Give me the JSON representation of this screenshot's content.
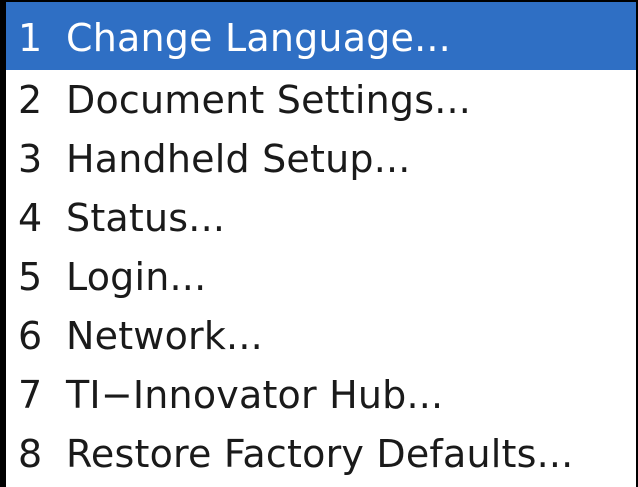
{
  "menu": {
    "selected_index": 0,
    "items": [
      {
        "num": "1",
        "label": "Change Language..."
      },
      {
        "num": "2",
        "label": "Document Settings..."
      },
      {
        "num": "3",
        "label": "Handheld Setup..."
      },
      {
        "num": "4",
        "label": "Status..."
      },
      {
        "num": "5",
        "label": "Login..."
      },
      {
        "num": "6",
        "label": "Network..."
      },
      {
        "num": "7",
        "label": "TI−Innovator Hub..."
      },
      {
        "num": "8",
        "label": "Restore Factory Defaults..."
      }
    ]
  },
  "colors": {
    "selection": "#2f6fc4",
    "text": "#1a1a1a",
    "selected_text": "#ffffff"
  }
}
